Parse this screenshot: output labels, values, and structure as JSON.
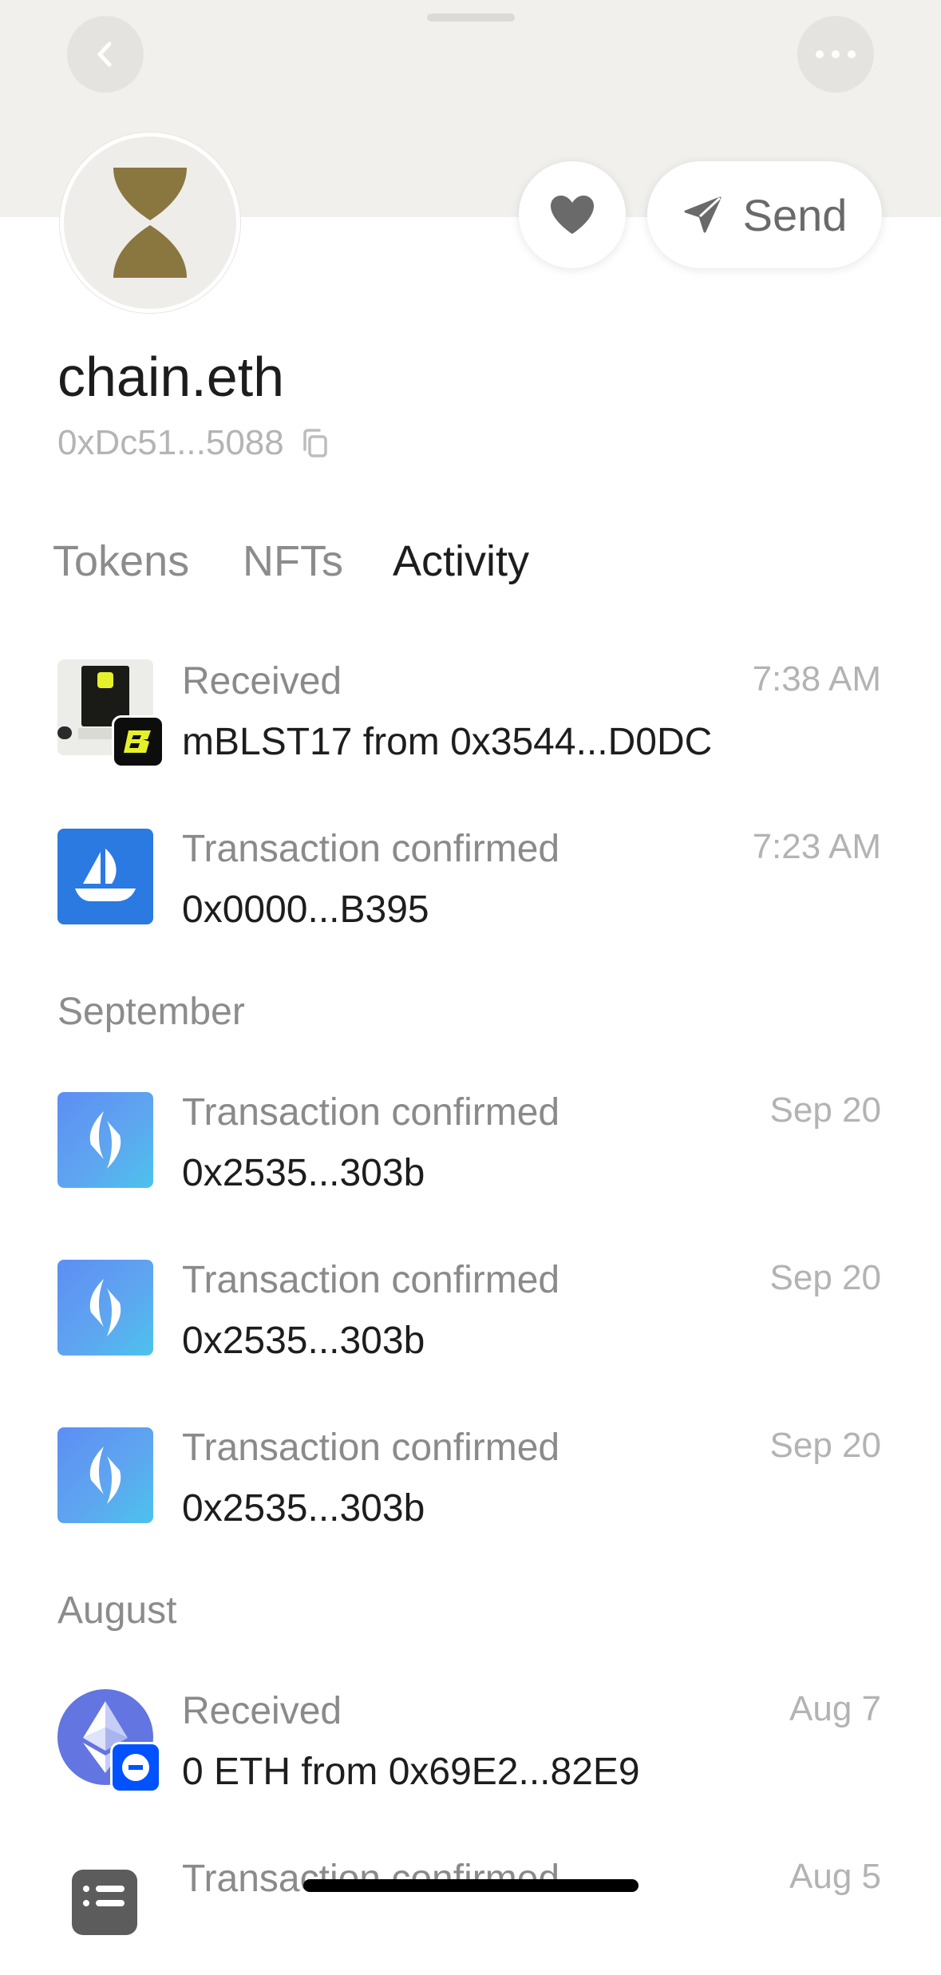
{
  "profile": {
    "name": "chain.eth",
    "address": "0xDc51...5088"
  },
  "actions": {
    "send_label": "Send"
  },
  "tabs": [
    {
      "label": "Tokens",
      "active": false
    },
    {
      "label": "NFTs",
      "active": false
    },
    {
      "label": "Activity",
      "active": true
    }
  ],
  "sections": {
    "september": "September",
    "august": "August"
  },
  "activity": [
    {
      "title": "Received",
      "subtitle": "mBLST17 from 0x3544...D0DC",
      "time": "7:38 AM",
      "icon": "blast-nft-icon"
    },
    {
      "title": "Transaction confirmed",
      "subtitle": "0x0000...B395",
      "time": "7:23 AM",
      "icon": "opensea-icon"
    },
    {
      "title": "Transaction confirmed",
      "subtitle": "0x2535...303b",
      "time": "Sep 20",
      "icon": "ens-icon"
    },
    {
      "title": "Transaction confirmed",
      "subtitle": "0x2535...303b",
      "time": "Sep 20",
      "icon": "ens-icon"
    },
    {
      "title": "Transaction confirmed",
      "subtitle": "0x2535...303b",
      "time": "Sep 20",
      "icon": "ens-icon"
    },
    {
      "title": "Received",
      "subtitle": "0 ETH from 0x69E2...82E9",
      "time": "Aug 7",
      "icon": "eth-icon"
    },
    {
      "title": "Transaction confirmed",
      "subtitle": "",
      "time": "Aug 5",
      "icon": "list-icon"
    }
  ],
  "colors": {
    "banner": "#f1f0ed",
    "avatar_glyph": "#8a7740",
    "ens_gradient_start": "#5d8ef4",
    "ens_gradient_end": "#4cc3ec",
    "opensea_blue": "#2a7ae2"
  }
}
